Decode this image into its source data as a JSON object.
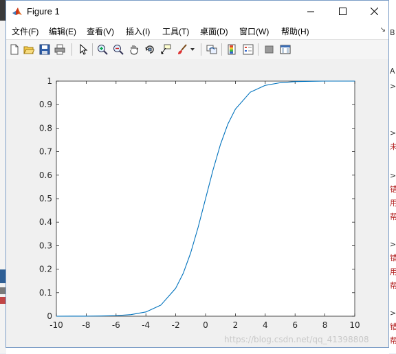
{
  "window": {
    "title": "Figure 1",
    "icon": "matlab-logo-icon"
  },
  "menu": [
    {
      "label": "文件(F)"
    },
    {
      "label": "编辑(E)"
    },
    {
      "label": "查看(V)"
    },
    {
      "label": "插入(I)"
    },
    {
      "label": "工具(T)"
    },
    {
      "label": "桌面(D)"
    },
    {
      "label": "窗口(W)"
    },
    {
      "label": "帮助(H)"
    }
  ],
  "toolbar_icons": [
    "new-figure-icon",
    "open-file-icon",
    "save-icon",
    "print-icon",
    "pointer-icon",
    "zoom-in-icon",
    "zoom-out-icon",
    "pan-hand-icon",
    "rotate-3d-icon",
    "data-cursor-icon",
    "brush-icon",
    "link-plot-icon",
    "colorbar-icon",
    "legend-icon",
    "hide-plot-tools-icon",
    "show-plot-tools-icon"
  ],
  "watermark": "https://blog.csdn.net/qq_41398808",
  "colors": {
    "line": "#0072bd",
    "axes_bg": "#ffffff",
    "figure_bg": "#f0f0f0"
  },
  "chart_data": {
    "type": "line",
    "title": "",
    "xlabel": "",
    "ylabel": "",
    "xlim": [
      -10,
      10
    ],
    "ylim": [
      0,
      1
    ],
    "xticks": [
      -10,
      -8,
      -6,
      -4,
      -2,
      0,
      2,
      4,
      6,
      8,
      10
    ],
    "yticks": [
      0,
      0.1,
      0.2,
      0.3,
      0.4,
      0.5,
      0.6,
      0.7,
      0.8,
      0.9,
      1
    ],
    "grid": false,
    "series": [
      {
        "x": [
          -10,
          -9,
          -8,
          -7,
          -6,
          -5,
          -4,
          -3,
          -2,
          -1.5,
          -1,
          -0.5,
          0,
          0.5,
          1,
          1.5,
          2,
          3,
          4,
          5,
          6,
          7,
          8,
          9,
          10
        ],
        "y": [
          0.0,
          0.0001,
          0.0003,
          0.0009,
          0.0025,
          0.0067,
          0.018,
          0.047,
          0.119,
          0.182,
          0.269,
          0.378,
          0.5,
          0.622,
          0.731,
          0.818,
          0.881,
          0.953,
          0.982,
          0.993,
          0.998,
          0.999,
          1.0,
          1.0,
          1.0
        ]
      }
    ]
  }
}
